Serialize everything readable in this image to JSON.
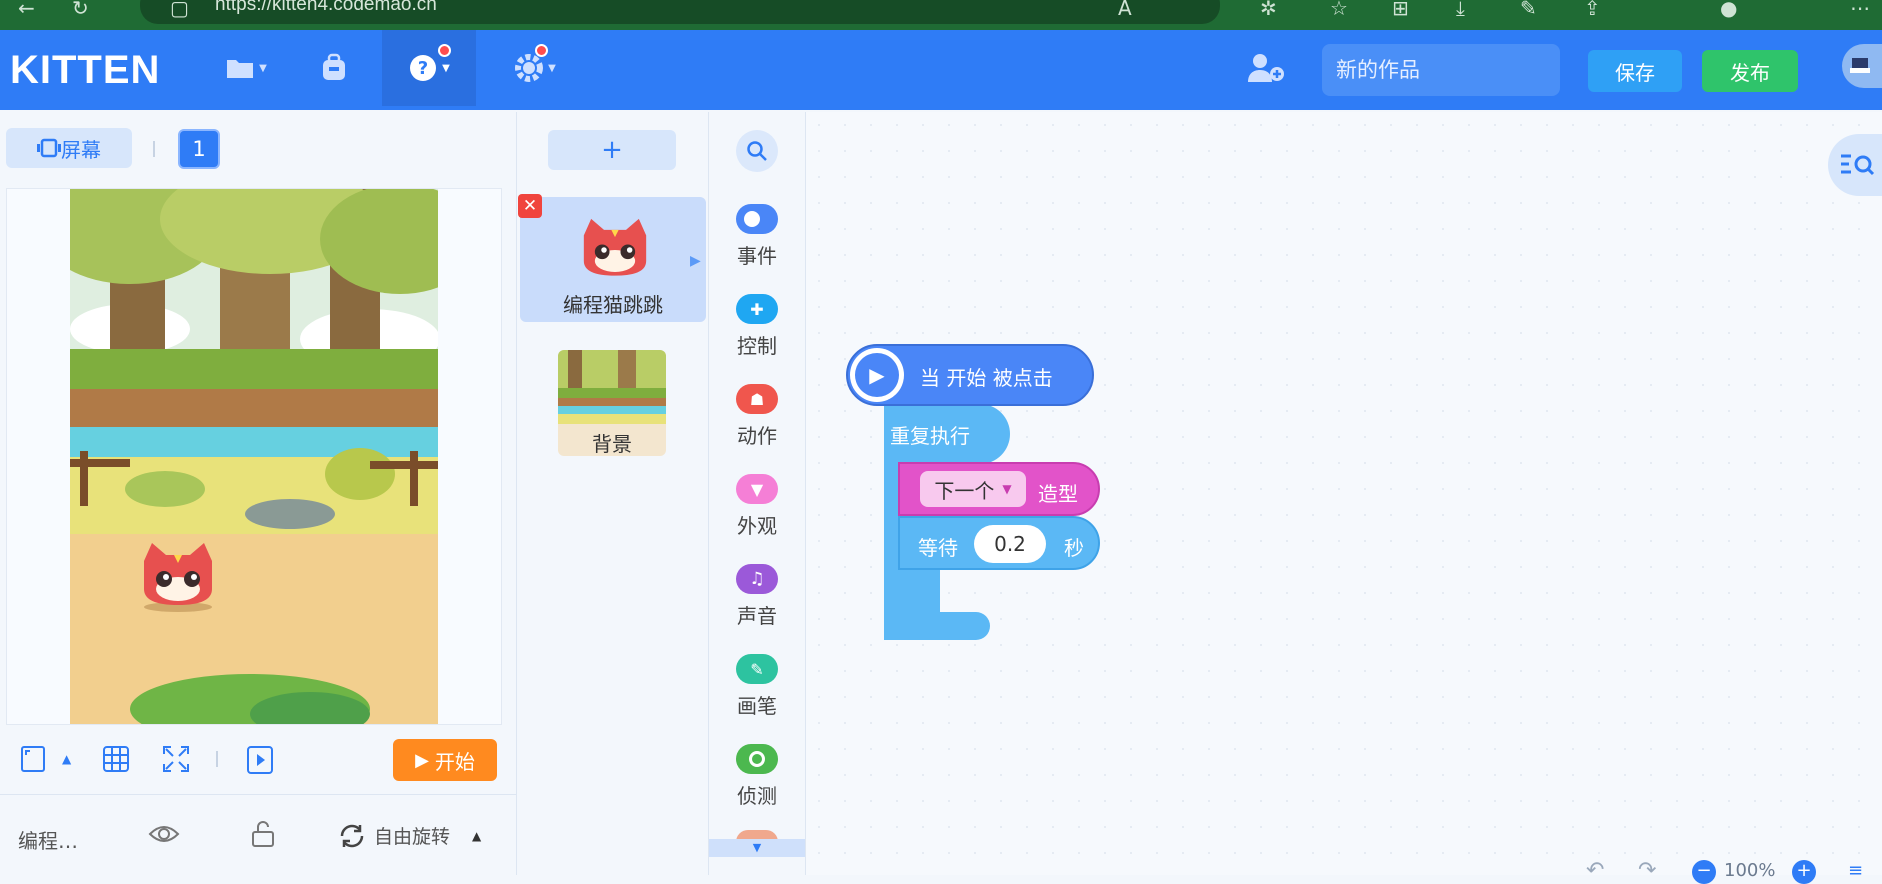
{
  "browser": {
    "url": "https://kitten4.codemao.cn"
  },
  "header": {
    "logo": "KITTEN",
    "tooltip": "帮助",
    "title_placeholder": "新的作品",
    "save_label": "保存",
    "publish_label": "发布"
  },
  "stage_panel": {
    "screen_label": "屏幕",
    "page_number": "1",
    "start_label": "开始",
    "sprite_name_short": "编程…",
    "rotation_label": "自由旋转"
  },
  "sprites": {
    "add_label": "+",
    "items": [
      {
        "name": "编程猫跳跳"
      }
    ],
    "background_label": "背景"
  },
  "categories": [
    {
      "label": "事件",
      "color": "#4a86f7"
    },
    {
      "label": "控制",
      "color": "#1fa7f2"
    },
    {
      "label": "动作",
      "color": "#f0564d"
    },
    {
      "label": "外观",
      "color": "#f57fd6"
    },
    {
      "label": "声音",
      "color": "#9b59d9"
    },
    {
      "label": "画笔",
      "color": "#2dc3a0"
    },
    {
      "label": "侦测",
      "color": "#4cb84f"
    }
  ],
  "blocks": {
    "hat": "当 开始 被点击",
    "repeat": "重复执行",
    "dropdown_value": "下一个",
    "costume_label": "造型",
    "wait_label": "等待",
    "wait_value": "0.2",
    "seconds_label": "秒"
  },
  "workspace": {
    "zoom": "100%"
  }
}
